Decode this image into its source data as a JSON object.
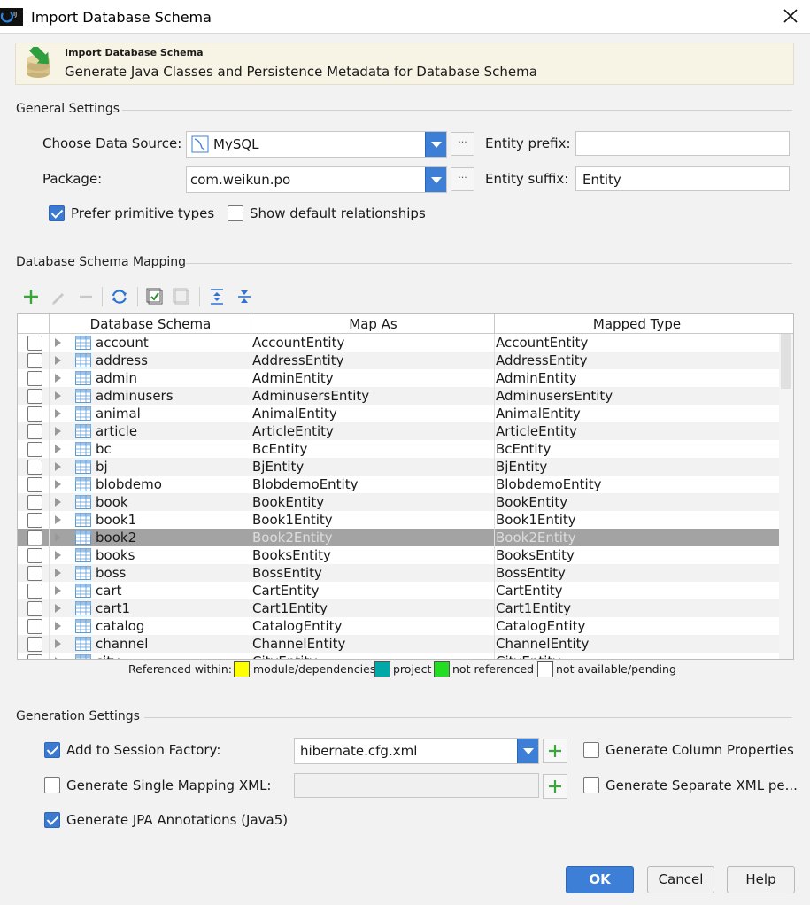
{
  "window": {
    "title": "Import Database Schema"
  },
  "header": {
    "title": "Import Database Schema",
    "subtitle": "Generate Java Classes and Persistence Metadata for Database Schema"
  },
  "general": {
    "section_title": "General Settings",
    "data_source_label": "Choose Data Source:",
    "data_source_value": "MySQL",
    "package_label": "Package:",
    "package_value": "com.weikun.po",
    "entity_prefix_label": "Entity prefix:",
    "entity_prefix_value": "",
    "entity_suffix_label": "Entity suffix:",
    "entity_suffix_value": "Entity",
    "prefer_primitive_label": "Prefer primitive types",
    "prefer_primitive_checked": true,
    "show_relationships_label": "Show default relationships",
    "show_relationships_checked": false,
    "browse_label": "···"
  },
  "mapping": {
    "section_title": "Database Schema Mapping",
    "columns": [
      "Database Schema",
      "Map As",
      "Mapped Type"
    ],
    "rows": [
      {
        "schema": "account",
        "map_as": "AccountEntity",
        "type": "AccountEntity"
      },
      {
        "schema": "address",
        "map_as": "AddressEntity",
        "type": "AddressEntity"
      },
      {
        "schema": "admin",
        "map_as": "AdminEntity",
        "type": "AdminEntity"
      },
      {
        "schema": "adminusers",
        "map_as": "AdminusersEntity",
        "type": "AdminusersEntity"
      },
      {
        "schema": "animal",
        "map_as": "AnimalEntity",
        "type": "AnimalEntity"
      },
      {
        "schema": "article",
        "map_as": "ArticleEntity",
        "type": "ArticleEntity"
      },
      {
        "schema": "bc",
        "map_as": "BcEntity",
        "type": "BcEntity"
      },
      {
        "schema": "bj",
        "map_as": "BjEntity",
        "type": "BjEntity"
      },
      {
        "schema": "blobdemo",
        "map_as": "BlobdemoEntity",
        "type": "BlobdemoEntity"
      },
      {
        "schema": "book",
        "map_as": "BookEntity",
        "type": "BookEntity"
      },
      {
        "schema": "book1",
        "map_as": "Book1Entity",
        "type": "Book1Entity"
      },
      {
        "schema": "book2",
        "map_as": "Book2Entity",
        "type": "Book2Entity",
        "selected": true
      },
      {
        "schema": "books",
        "map_as": "BooksEntity",
        "type": "BooksEntity"
      },
      {
        "schema": "boss",
        "map_as": "BossEntity",
        "type": "BossEntity"
      },
      {
        "schema": "cart",
        "map_as": "CartEntity",
        "type": "CartEntity"
      },
      {
        "schema": "cart1",
        "map_as": "Cart1Entity",
        "type": "Cart1Entity"
      },
      {
        "schema": "catalog",
        "map_as": "CatalogEntity",
        "type": "CatalogEntity"
      },
      {
        "schema": "channel",
        "map_as": "ChannelEntity",
        "type": "ChannelEntity"
      },
      {
        "schema": "city",
        "map_as": "CityEntity",
        "type": "CityEntity"
      }
    ],
    "legend": {
      "prefix": "Referenced within:",
      "items": [
        {
          "label": "module/dependencies",
          "color": "#ffff00"
        },
        {
          "label": "project",
          "color": "#00a8a8"
        },
        {
          "label": "not referenced",
          "color": "#22dd22"
        },
        {
          "label": "not available/pending",
          "color": "#ffffff"
        }
      ]
    },
    "toolbar_icons": [
      "add-icon",
      "edit-icon",
      "remove-icon",
      "refresh-icon",
      "check-all-icon",
      "uncheck-all-icon",
      "expand-all-icon",
      "collapse-all-icon"
    ]
  },
  "generation": {
    "section_title": "Generation Settings",
    "session_factory_label": "Add to Session Factory:",
    "session_factory_checked": true,
    "session_factory_value": "hibernate.cfg.xml",
    "single_mapping_label": "Generate Single Mapping XML:",
    "single_mapping_checked": false,
    "single_mapping_value": "",
    "jpa_label": "Generate JPA Annotations (Java5)",
    "jpa_checked": true,
    "column_props_label": "Generate Column Properties",
    "column_props_checked": false,
    "separate_xml_label": "Generate Separate XML pe...",
    "separate_xml_checked": false
  },
  "buttons": {
    "ok": "OK",
    "cancel": "Cancel",
    "help": "Help"
  },
  "colors": {
    "accent": "#3d7fd6",
    "header_bg": "#f7f4e6",
    "selected_row": "#a3a3a3"
  }
}
